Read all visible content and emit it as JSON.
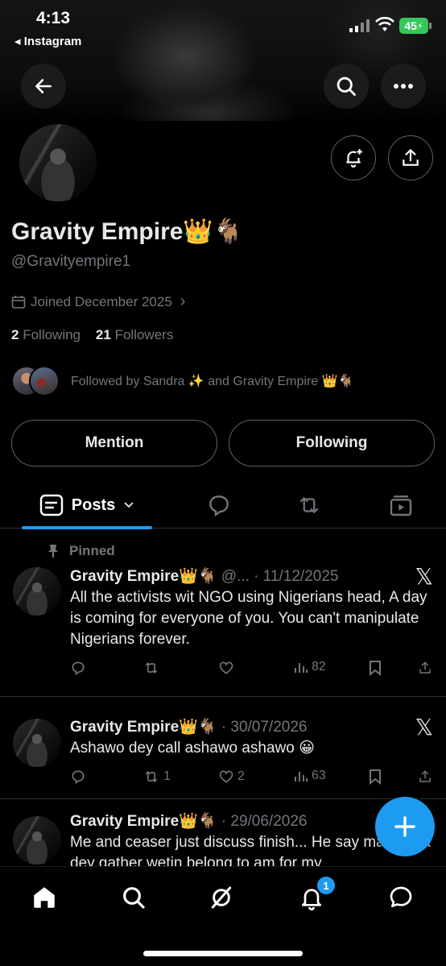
{
  "status_bar": {
    "time": "4:13",
    "back_app": "◂ Instagram",
    "battery": "45"
  },
  "profile": {
    "name": "Gravity Empire👑🐐",
    "handle": "@Gravityempire1",
    "joined": "Joined December 2025",
    "following_count": "2",
    "following_label": "Following",
    "followers_count": "21",
    "followers_label": "Followers",
    "followed_by": "Followed by Sandra ✨ and Gravity Empire 👑🐐"
  },
  "buttons": {
    "mention": "Mention",
    "following": "Following"
  },
  "tabs": {
    "posts": "Posts"
  },
  "posts": [
    {
      "pinned_label": "Pinned",
      "name": "Gravity Empire👑🐐",
      "meta": " @... · 11/12/2025",
      "text": "All the activists wit NGO using Nigerians head, A day is coming for everyone of you. You can't manipulate Nigerians forever.",
      "replies": "",
      "reposts": "",
      "likes": "",
      "views": "82"
    },
    {
      "name": "Gravity Empire👑🐐",
      "meta": " · 30/07/2026",
      "text": "Ashawo dey call ashawo ashawo 😀",
      "replies": "",
      "reposts": "1",
      "likes": "2",
      "views": "63"
    },
    {
      "name": "Gravity Empire👑🐐",
      "meta": " · 29/06/2026",
      "text": "Me and ceaser just discuss finish... He say make una dey gather wetin belong to am for my",
      "replies": "",
      "reposts": "",
      "likes": "",
      "views": ""
    }
  ],
  "nav": {
    "notifications_badge": "1"
  },
  "colors": {
    "accent": "#1d9bf0",
    "background": "#000000",
    "muted": "#71767b"
  }
}
